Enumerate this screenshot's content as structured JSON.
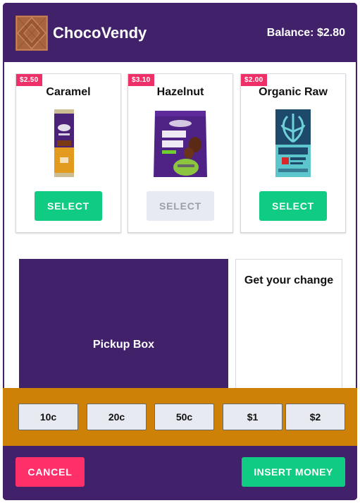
{
  "header": {
    "app_title": "ChocoVendy",
    "logo_icon": "chocolate-bar-icon",
    "balance_label": "Balance:",
    "balance_value": "$2.80"
  },
  "products": [
    {
      "price": "$2.50",
      "name": "Caramel",
      "image_icon": "caramel-chocolate-bar-icon",
      "select_label": "SELECT",
      "available": true
    },
    {
      "price": "$3.10",
      "name": "Hazelnut",
      "image_icon": "hazelnut-bites-bag-icon",
      "select_label": "SELECT",
      "available": false
    },
    {
      "price": "$2.00",
      "name": "Organic Raw",
      "image_icon": "organic-chocolate-bar-icon",
      "select_label": "SELECT",
      "available": true
    }
  ],
  "pickup": {
    "label": "Pickup Box"
  },
  "change": {
    "label": "Get your change"
  },
  "coins": [
    "10c",
    "20c",
    "50c",
    "$1",
    "$2"
  ],
  "footer": {
    "cancel_label": "CANCEL",
    "insert_label": "INSERT MONEY"
  },
  "colors": {
    "brand_purple": "#42216b",
    "accent_green": "#0fcc82",
    "cancel_pink": "#ff2f6a",
    "price_tag_pink": "#ef2f67",
    "coin_bar_orange": "#cd8106",
    "disabled_grey": "#e7eaf1"
  }
}
